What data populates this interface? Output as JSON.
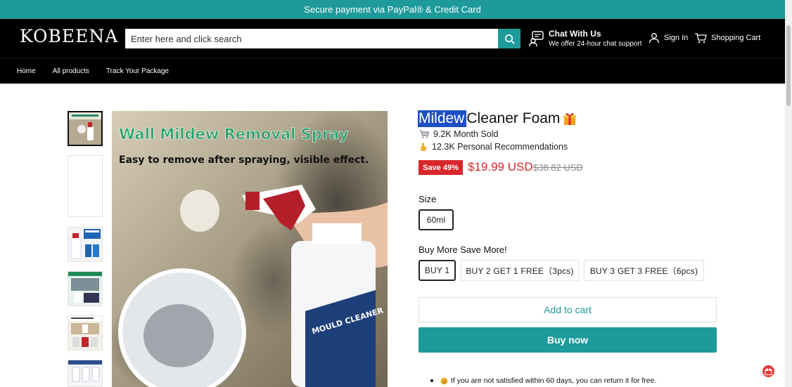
{
  "announcement": "Secure payment via PayPal® & Credit Card",
  "header": {
    "logo": "KOBEENA",
    "search_placeholder": "Enter here and click search",
    "chat_title": "Chat With Us",
    "chat_subtitle": "We offer 24-hour chat support",
    "sign_in": "Sign In",
    "cart": "Shopping Cart"
  },
  "nav": [
    "Home",
    "All products",
    "Track Your Package"
  ],
  "main_image": {
    "headline": "Wall Mildew Removal Spray",
    "subline": "Easy to remove after spraying, visible effect.",
    "bottle_label": "MOULD CLEANER"
  },
  "product": {
    "title_highlight": "Mildew",
    "title_rest": "Cleaner Foam",
    "sold": "9.2K Month Sold",
    "recommendations": "12.3K Personal Recommendations",
    "save_badge": "Save 49%",
    "price": "$19.99 USD",
    "compare_price": "$38.82 USD"
  },
  "size": {
    "label": "Size",
    "options": [
      "60ml"
    ],
    "selected": "60ml"
  },
  "bundle": {
    "label": "Buy More Save More!",
    "options": [
      "BUY 1",
      "BUY 2 GET 1 FREE（3pcs)",
      "BUY 3 GET 3 FREE（6pcs)"
    ],
    "selected": "BUY 1"
  },
  "actions": {
    "add_to_cart": "Add to cart",
    "buy_now": "Buy now"
  },
  "guarantee": "If you are not satisfied within 60 days, you can return it for free.",
  "colors": {
    "accent": "#1e9a9a",
    "sale": "#d8262a",
    "header_bg": "#000000"
  }
}
